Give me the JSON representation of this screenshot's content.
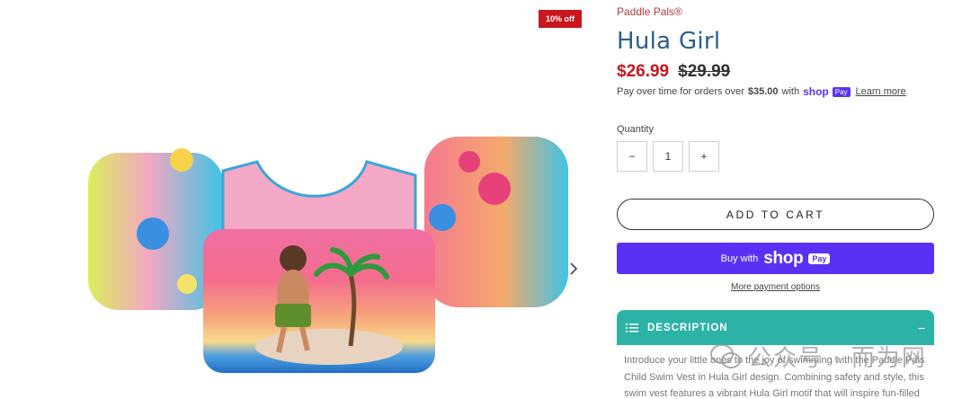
{
  "badge": {
    "discount": "10% off"
  },
  "product": {
    "vendor": "Paddle Pals®",
    "title": "Hula Girl",
    "price_sale": "$26.99",
    "price_compare": "$29.99",
    "installments": {
      "prefix": "Pay over time for orders over",
      "amount": "$35.00",
      "with": "with",
      "shop_word": "shop",
      "pay_pill": "Pay",
      "learn_more": "Learn more"
    }
  },
  "quantity": {
    "label": "Quantity",
    "value": "1",
    "minus": "−",
    "plus": "+"
  },
  "buttons": {
    "add_to_cart": "ADD TO CART",
    "buy_with": "Buy with",
    "shop_logo": "shop",
    "pay_badge": "Pay",
    "more_options": "More payment options"
  },
  "description": {
    "heading": "DESCRIPTION",
    "toggle": "−",
    "lines": [
      "Introduce your little ones to the joy of swimming with the Paddle Pals",
      "Child Swim Vest in Hula Girl design. Combining safety and style, this",
      "swim vest features a vibrant Hula Girl motif that will inspire fun-filled"
    ]
  },
  "watermark": {
    "text": "公众号 · 而为网"
  },
  "icons": {
    "next": "chevron-right-icon",
    "list": "list-icon",
    "watermark_logo": "wechat-icon"
  },
  "colors": {
    "accent_red": "#c8161d",
    "title_blue": "#2a5f8c",
    "shop_purple": "#5a31f4",
    "accordion_teal": "#2db3a6"
  }
}
